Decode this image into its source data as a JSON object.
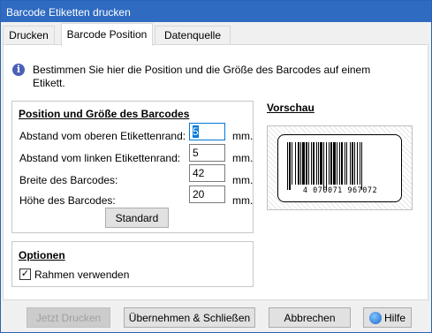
{
  "window": {
    "title": "Barcode Etiketten drucken"
  },
  "tabs": [
    {
      "label": "Drucken",
      "active": false
    },
    {
      "label": "Barcode Position",
      "active": true
    },
    {
      "label": "Datenquelle",
      "active": false
    }
  ],
  "info": {
    "icon": "info-icon",
    "text": "Bestimmen Sie hier die Position und die Größe des Barcodes auf einem Etikett."
  },
  "position_group": {
    "title": "Position und Größe des Barcodes",
    "fields": [
      {
        "label": "Abstand vom oberen Etikettenrand:",
        "value": "5",
        "unit": "mm."
      },
      {
        "label": "Abstand vom linken Etikettenrand:",
        "value": "5",
        "unit": "mm."
      },
      {
        "label": "Breite des Barcodes:",
        "value": "42",
        "unit": "mm."
      },
      {
        "label": "Höhe des Barcodes:",
        "value": "20",
        "unit": "mm."
      }
    ],
    "standard_button": "Standard"
  },
  "preview": {
    "title": "Vorschau",
    "digits": "4 070071 967072"
  },
  "options_group": {
    "title": "Optionen",
    "checkbox_label": "Rahmen verwenden",
    "checked": true
  },
  "buttons": {
    "print": "Jetzt Drucken",
    "apply_close": "Übernehmen & Schließen",
    "cancel": "Abbrechen",
    "help": "Hilfe"
  }
}
